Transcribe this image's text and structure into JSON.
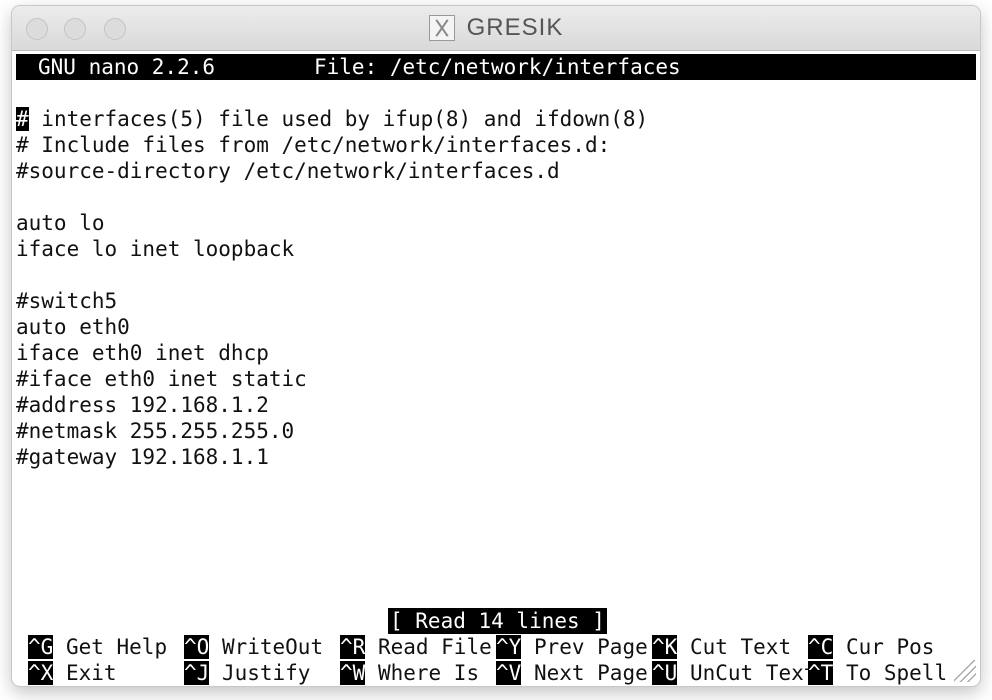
{
  "window": {
    "title": "GRESIK",
    "x_icon": "x11-icon"
  },
  "status_bar": {
    "app": "GNU nano 2.2.6",
    "file": "File: /etc/network/interfaces"
  },
  "buffer": {
    "cursor_char": "#",
    "first_line_rest": " interfaces(5) file used by ifup(8) and ifdown(8)",
    "lines": [
      "# Include files from /etc/network/interfaces.d:",
      "#source-directory /etc/network/interfaces.d",
      "",
      "auto lo",
      "iface lo inet loopback",
      "",
      "#switch5",
      "auto eth0",
      "iface eth0 inet dhcp",
      "#iface eth0 inet static",
      "#address 192.168.1.2",
      "#netmask 255.255.255.0",
      "#gateway 192.168.1.1"
    ]
  },
  "message": "[ Read 14 lines ]",
  "shortcuts": [
    [
      {
        "key": "^G",
        "label": "Get Help"
      },
      {
        "key": "^O",
        "label": "WriteOut"
      },
      {
        "key": "^R",
        "label": "Read File"
      },
      {
        "key": "^Y",
        "label": "Prev Page"
      },
      {
        "key": "^K",
        "label": "Cut Text"
      },
      {
        "key": "^C",
        "label": "Cur Pos"
      }
    ],
    [
      {
        "key": "^X",
        "label": "Exit"
      },
      {
        "key": "^J",
        "label": "Justify"
      },
      {
        "key": "^W",
        "label": "Where Is"
      },
      {
        "key": "^V",
        "label": "Next Page"
      },
      {
        "key": "^U",
        "label": "UnCut Text"
      },
      {
        "key": "^T",
        "label": "To Spell"
      }
    ]
  ]
}
